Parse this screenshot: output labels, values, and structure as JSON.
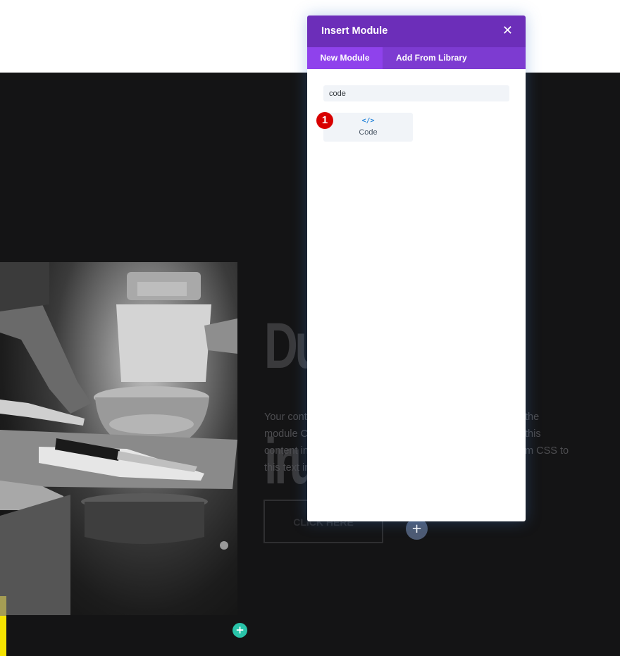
{
  "modal": {
    "title": "Insert Module",
    "close_icon": "close-icon",
    "tabs": [
      {
        "label": "New Module",
        "active": true
      },
      {
        "label": "Add From Library",
        "active": false
      }
    ],
    "search": {
      "value": "code"
    },
    "modules": [
      {
        "label": "Code",
        "icon": "code-icon",
        "icon_glyph": "</>"
      }
    ],
    "colors": {
      "header": "#6c2eb9",
      "tabs": "#7d3bd1",
      "active_tab": "#8f42ec"
    }
  },
  "annotation": {
    "step": "1",
    "color": "#d80000"
  },
  "page": {
    "heading_lines": [
      "Du",
      "iru"
    ],
    "body_lines": [
      {
        "left": "Your conte",
        "right": "the"
      },
      {
        "left": "module Co",
        "right": "this"
      },
      {
        "left": "content in",
        "right": "m CSS to"
      },
      {
        "left": "this text in",
        "right": ""
      }
    ],
    "cta_label": "Click Here",
    "row_add": "+",
    "section_add": "+"
  }
}
